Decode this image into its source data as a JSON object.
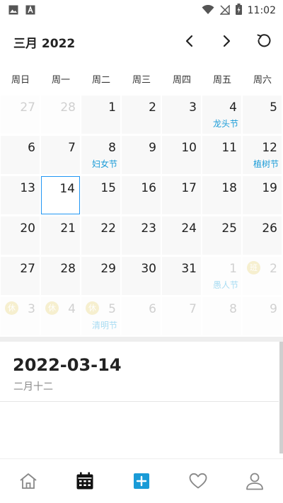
{
  "status_bar": {
    "time": "11:02",
    "icons": [
      "image-icon",
      "font-icon",
      "wifi-icon",
      "no-signal-icon",
      "battery-charging-icon"
    ]
  },
  "header": {
    "title": "三月 2022",
    "icons": [
      "chevron-left-icon",
      "chevron-right-icon",
      "refresh-icon"
    ]
  },
  "weekdays": [
    "周日",
    "周一",
    "周二",
    "周三",
    "周四",
    "周五",
    "周六"
  ],
  "calendar": {
    "selected": "14",
    "weeks": [
      [
        {
          "d": "27",
          "other": true
        },
        {
          "d": "28",
          "other": true
        },
        {
          "d": "1"
        },
        {
          "d": "2"
        },
        {
          "d": "3"
        },
        {
          "d": "4",
          "fest": "龙头节"
        },
        {
          "d": "5"
        }
      ],
      [
        {
          "d": "6"
        },
        {
          "d": "7"
        },
        {
          "d": "8",
          "fest": "妇女节"
        },
        {
          "d": "9"
        },
        {
          "d": "10"
        },
        {
          "d": "11"
        },
        {
          "d": "12",
          "fest": "植树节"
        }
      ],
      [
        {
          "d": "13"
        },
        {
          "d": "14",
          "selected": true
        },
        {
          "d": "15"
        },
        {
          "d": "16"
        },
        {
          "d": "17"
        },
        {
          "d": "18"
        },
        {
          "d": "19"
        }
      ],
      [
        {
          "d": "20"
        },
        {
          "d": "21"
        },
        {
          "d": "22"
        },
        {
          "d": "23"
        },
        {
          "d": "24"
        },
        {
          "d": "25"
        },
        {
          "d": "26"
        }
      ],
      [
        {
          "d": "27"
        },
        {
          "d": "28"
        },
        {
          "d": "29"
        },
        {
          "d": "30"
        },
        {
          "d": "31"
        },
        {
          "d": "1",
          "other": true,
          "fest": "愚人节"
        },
        {
          "d": "2",
          "other": true,
          "badge": "班"
        }
      ],
      [
        {
          "d": "3",
          "other": true,
          "badge": "休"
        },
        {
          "d": "4",
          "other": true,
          "badge": "休"
        },
        {
          "d": "5",
          "other": true,
          "badge": "休",
          "fest": "清明节"
        },
        {
          "d": "6",
          "other": true
        },
        {
          "d": "7",
          "other": true
        },
        {
          "d": "8",
          "other": true
        },
        {
          "d": "9",
          "other": true
        }
      ]
    ]
  },
  "detail": {
    "date": "2022-03-14",
    "lunar": "二月十二"
  },
  "colors": {
    "accent": "#2196f3",
    "festival": "#1a9bd7",
    "badge": "#f4e9b8"
  },
  "bottom_nav": {
    "items": [
      "home-icon",
      "calendar-icon",
      "add-icon",
      "heart-icon",
      "user-icon"
    ],
    "active": "calendar-icon"
  }
}
